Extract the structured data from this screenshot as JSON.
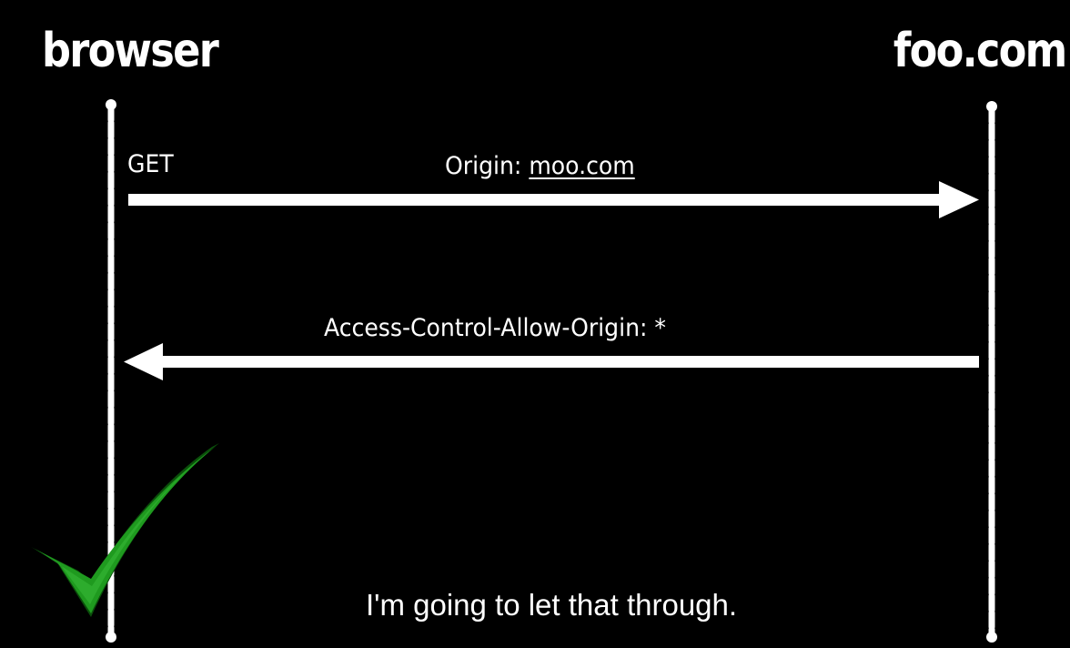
{
  "actors": {
    "left": "browser",
    "right": "foo.com"
  },
  "request": {
    "method": "GET",
    "header_name": "Origin: ",
    "header_value": "moo.com"
  },
  "response": {
    "header": "Access-Control-Allow-Origin: *"
  },
  "caption": "I'm going to let that through.",
  "colors": {
    "background": "#000000",
    "foreground": "#ffffff",
    "check_fill": "#1f9a1f",
    "check_edge": "#0b4f0b"
  },
  "icons": {
    "status": "checkmark-icon"
  }
}
